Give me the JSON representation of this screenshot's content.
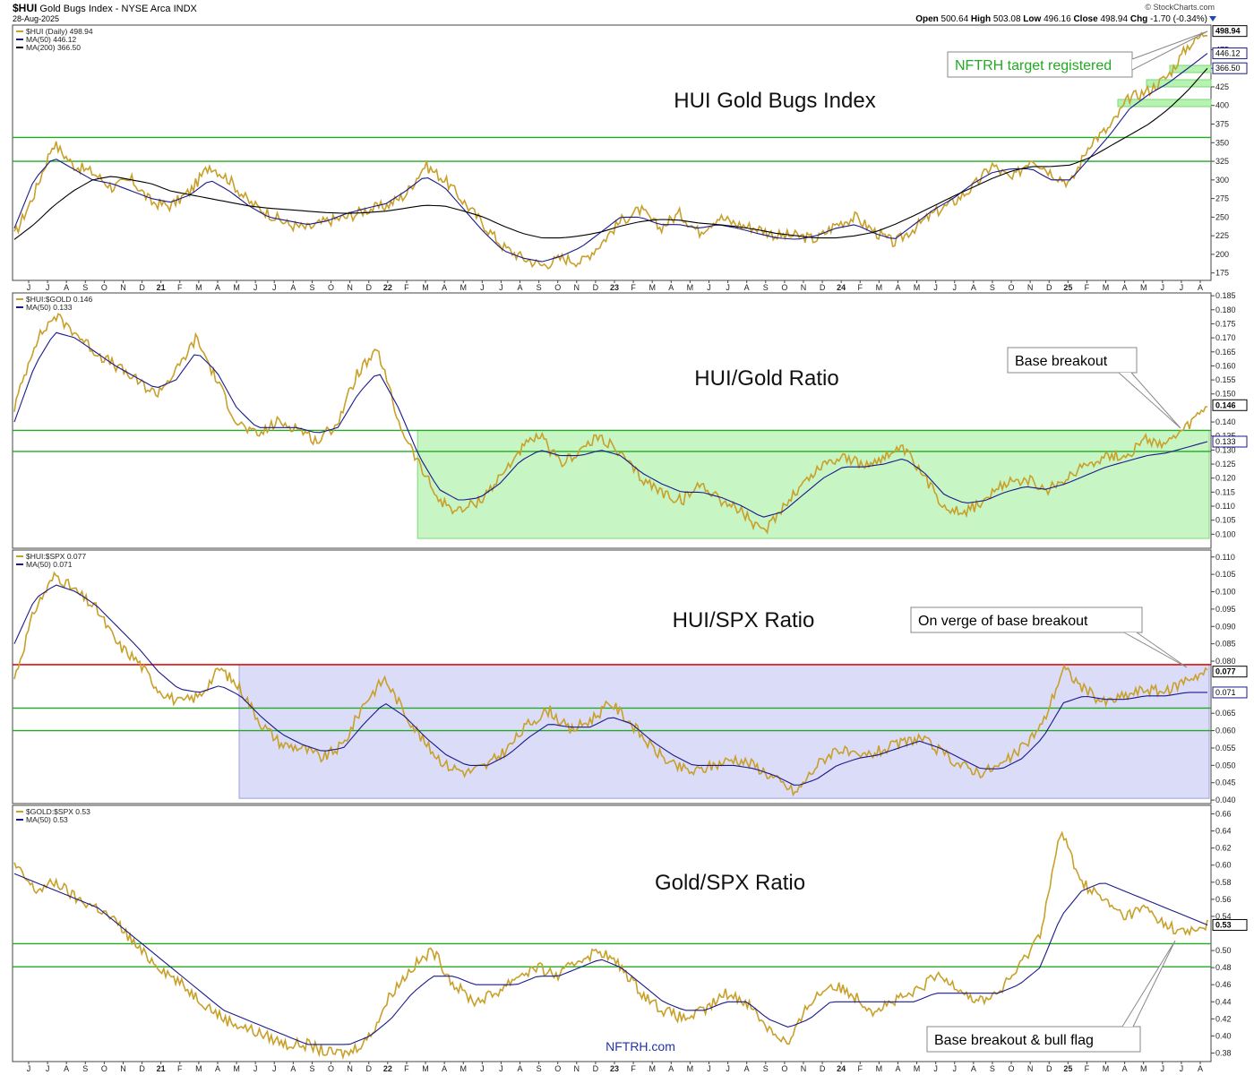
{
  "header": {
    "symbol": "$HUI",
    "name": "Gold Bugs Index - NYSE Arca INDX",
    "date": "28-Aug-2025",
    "credit": "© StockCharts.com",
    "open_label": "Open",
    "open": "500.64",
    "high_label": "High",
    "high": "503.08",
    "low_label": "Low",
    "low": "496.16",
    "close_label": "Close",
    "close": "498.94",
    "chg_label": "Chg",
    "chg": "-1.70 (-0.34%)"
  },
  "watermark": "NFTRH.com",
  "x_axis": {
    "months": [
      "J",
      "J",
      "A",
      "S",
      "O",
      "N",
      "D",
      "21",
      "F",
      "M",
      "A",
      "M",
      "J",
      "J",
      "A",
      "S",
      "O",
      "N",
      "D",
      "22",
      "F",
      "M",
      "A",
      "M",
      "J",
      "J",
      "A",
      "S",
      "O",
      "N",
      "D",
      "23",
      "F",
      "M",
      "A",
      "M",
      "J",
      "J",
      "A",
      "S",
      "O",
      "N",
      "D",
      "24",
      "F",
      "M",
      "A",
      "M",
      "J",
      "J",
      "A",
      "S",
      "O",
      "N",
      "D",
      "25",
      "F",
      "M",
      "A",
      "M",
      "J",
      "J",
      "A"
    ]
  },
  "colors": {
    "price": "#c8a02a",
    "ma50": "#1a1a8c",
    "ma200": "#000000",
    "support": "#22aa22",
    "resistance": "#dd1111",
    "green_zone": "#b6f2b0",
    "blue_zone": "#cfd0f5"
  },
  "chart_data": [
    {
      "type": "line",
      "title": "HUI Gold Bugs Index",
      "legend": [
        "$HUI (Daily) 498.94",
        "MA(50) 446.12",
        "MA(200) 366.50"
      ],
      "series": [
        {
          "name": "$HUI (Daily)",
          "values": [
            225,
            280,
            350,
            320,
            310,
            290,
            300,
            270,
            265,
            285,
            320,
            300,
            270,
            255,
            240,
            235,
            245,
            250,
            260,
            265,
            280,
            320,
            300,
            270,
            240,
            210,
            195,
            185,
            195,
            190,
            215,
            245,
            260,
            235,
            255,
            230,
            250,
            240,
            235,
            225,
            225,
            220,
            240,
            250,
            230,
            215,
            235,
            255,
            270,
            290,
            320,
            300,
            330,
            310,
            295,
            350,
            370,
            410,
            420,
            440,
            480,
            500
          ]
        },
        {
          "name": "MA(50)",
          "values": [
            235,
            300,
            330,
            315,
            300,
            295,
            285,
            275,
            270,
            280,
            300,
            285,
            265,
            250,
            245,
            240,
            245,
            255,
            262,
            268,
            285,
            305,
            290,
            260,
            230,
            205,
            195,
            190,
            198,
            210,
            230,
            250,
            250,
            240,
            240,
            235,
            240,
            235,
            228,
            222,
            220,
            225,
            235,
            240,
            228,
            220,
            240,
            260,
            275,
            295,
            310,
            315,
            315,
            300,
            300,
            330,
            360,
            395,
            415,
            430,
            450,
            470
          ]
        },
        {
          "name": "MA(200)",
          "values": [
            220,
            240,
            265,
            285,
            300,
            305,
            300,
            295,
            285,
            280,
            275,
            270,
            265,
            262,
            260,
            258,
            256,
            255,
            256,
            258,
            262,
            266,
            265,
            258,
            250,
            238,
            228,
            222,
            222,
            225,
            230,
            238,
            244,
            247,
            246,
            242,
            240,
            237,
            233,
            228,
            225,
            222,
            222,
            225,
            230,
            240,
            252,
            265,
            278,
            290,
            302,
            312,
            318,
            318,
            320,
            330,
            345,
            360,
            375,
            395,
            420,
            450
          ]
        }
      ],
      "levels": [
        357,
        325
      ],
      "ylim": [
        165,
        508
      ],
      "y_ticks": [
        "475",
        "450",
        "425",
        "400",
        "375",
        "350",
        "325",
        "300",
        "275",
        "250",
        "225",
        "200",
        "175"
      ],
      "last_labels": [
        "498.94",
        "446.12",
        "366.50"
      ],
      "annotation": "NFTRH target registered"
    },
    {
      "type": "line",
      "title": "HUI/Gold Ratio",
      "legend": [
        "$HUI:$GOLD 0.146",
        "MA(50) 0.133"
      ],
      "series": [
        {
          "name": "$HUI:$GOLD",
          "values": [
            0.145,
            0.168,
            0.178,
            0.172,
            0.165,
            0.16,
            0.155,
            0.15,
            0.158,
            0.17,
            0.155,
            0.14,
            0.135,
            0.14,
            0.138,
            0.133,
            0.14,
            0.158,
            0.165,
            0.14,
            0.125,
            0.112,
            0.108,
            0.112,
            0.12,
            0.13,
            0.135,
            0.125,
            0.13,
            0.135,
            0.128,
            0.12,
            0.115,
            0.112,
            0.118,
            0.112,
            0.108,
            0.1,
            0.11,
            0.118,
            0.125,
            0.128,
            0.124,
            0.128,
            0.13,
            0.12,
            0.11,
            0.108,
            0.112,
            0.118,
            0.12,
            0.115,
            0.12,
            0.125,
            0.128,
            0.128,
            0.134,
            0.132,
            0.138,
            0.146
          ]
        },
        {
          "name": "MA(50)",
          "values": [
            0.14,
            0.16,
            0.172,
            0.17,
            0.165,
            0.16,
            0.156,
            0.152,
            0.155,
            0.165,
            0.158,
            0.145,
            0.138,
            0.138,
            0.138,
            0.136,
            0.138,
            0.15,
            0.158,
            0.145,
            0.128,
            0.116,
            0.112,
            0.113,
            0.118,
            0.126,
            0.13,
            0.128,
            0.128,
            0.13,
            0.128,
            0.122,
            0.118,
            0.115,
            0.115,
            0.113,
            0.11,
            0.106,
            0.108,
            0.114,
            0.12,
            0.124,
            0.124,
            0.125,
            0.127,
            0.122,
            0.114,
            0.111,
            0.112,
            0.115,
            0.117,
            0.116,
            0.118,
            0.121,
            0.124,
            0.126,
            0.128,
            0.129,
            0.131,
            0.133
          ]
        }
      ],
      "levels": [
        0.137,
        0.1295
      ],
      "zone": {
        "from_index": 20,
        "y_range": [
          0.0985,
          0.137
        ]
      },
      "ylim": [
        0.095,
        0.186
      ],
      "y_ticks": [
        "0.185",
        "0.180",
        "0.175",
        "0.170",
        "0.165",
        "0.160",
        "0.155",
        "0.150",
        "0.140",
        "0.135",
        "0.130",
        "0.125",
        "0.120",
        "0.115",
        "0.110",
        "0.105",
        "0.100"
      ],
      "last_labels": [
        "0.146",
        "0.133"
      ],
      "annotation": "Base breakout"
    },
    {
      "type": "line",
      "title": "HUI/SPX Ratio",
      "legend": [
        "$HUI:$SPX 0.077",
        "MA(50) 0.071"
      ],
      "series": [
        {
          "name": "$HUI:$SPX",
          "values": [
            0.075,
            0.095,
            0.105,
            0.1,
            0.095,
            0.085,
            0.08,
            0.072,
            0.068,
            0.07,
            0.078,
            0.072,
            0.062,
            0.056,
            0.055,
            0.052,
            0.056,
            0.068,
            0.075,
            0.065,
            0.056,
            0.05,
            0.048,
            0.05,
            0.055,
            0.062,
            0.066,
            0.06,
            0.063,
            0.068,
            0.062,
            0.055,
            0.05,
            0.048,
            0.05,
            0.052,
            0.05,
            0.046,
            0.042,
            0.05,
            0.055,
            0.052,
            0.054,
            0.056,
            0.058,
            0.054,
            0.05,
            0.048,
            0.05,
            0.055,
            0.062,
            0.078,
            0.072,
            0.068,
            0.07,
            0.072,
            0.071,
            0.075,
            0.077
          ]
        },
        {
          "name": "MA(50)",
          "values": [
            0.085,
            0.098,
            0.102,
            0.1,
            0.096,
            0.09,
            0.084,
            0.077,
            0.072,
            0.071,
            0.073,
            0.07,
            0.064,
            0.059,
            0.056,
            0.054,
            0.055,
            0.062,
            0.068,
            0.064,
            0.058,
            0.053,
            0.05,
            0.05,
            0.053,
            0.058,
            0.062,
            0.061,
            0.061,
            0.064,
            0.062,
            0.057,
            0.053,
            0.05,
            0.05,
            0.05,
            0.049,
            0.047,
            0.044,
            0.046,
            0.05,
            0.052,
            0.053,
            0.055,
            0.057,
            0.055,
            0.052,
            0.049,
            0.049,
            0.052,
            0.058,
            0.068,
            0.07,
            0.069,
            0.069,
            0.07,
            0.07,
            0.071,
            0.071
          ]
        }
      ],
      "levels": [
        0.0665,
        0.06
      ],
      "resistance": 0.079,
      "zone": {
        "from_index": 11,
        "y_range": [
          0.0405,
          0.079
        ]
      },
      "ylim": [
        0.039,
        0.112
      ],
      "y_ticks": [
        "0.110",
        "0.105",
        "0.100",
        "0.095",
        "0.090",
        "0.085",
        "0.080",
        "0.065",
        "0.060",
        "0.055",
        "0.050",
        "0.045",
        "0.040"
      ],
      "last_labels": [
        "0.077",
        "0.071"
      ],
      "annotation": "On verge of base breakout"
    },
    {
      "type": "line",
      "title": "Gold/SPX Ratio",
      "legend": [
        "$GOLD:$SPX 0.53",
        "MA(50) 0.53"
      ],
      "series": [
        {
          "name": "$GOLD:$SPX",
          "values": [
            0.6,
            0.57,
            0.58,
            0.56,
            0.55,
            0.53,
            0.5,
            0.48,
            0.46,
            0.44,
            0.42,
            0.41,
            0.4,
            0.39,
            0.39,
            0.38,
            0.38,
            0.4,
            0.45,
            0.48,
            0.5,
            0.46,
            0.44,
            0.45,
            0.47,
            0.48,
            0.47,
            0.49,
            0.5,
            0.48,
            0.45,
            0.43,
            0.42,
            0.43,
            0.45,
            0.44,
            0.41,
            0.39,
            0.44,
            0.46,
            0.45,
            0.43,
            0.44,
            0.45,
            0.47,
            0.46,
            0.44,
            0.45,
            0.48,
            0.52,
            0.64,
            0.58,
            0.56,
            0.54,
            0.55,
            0.53,
            0.52,
            0.53
          ]
        },
        {
          "name": "MA(50)",
          "values": [
            0.59,
            0.58,
            0.57,
            0.56,
            0.55,
            0.53,
            0.51,
            0.49,
            0.47,
            0.45,
            0.43,
            0.42,
            0.41,
            0.4,
            0.39,
            0.39,
            0.39,
            0.4,
            0.42,
            0.45,
            0.47,
            0.47,
            0.46,
            0.46,
            0.46,
            0.47,
            0.47,
            0.48,
            0.49,
            0.48,
            0.46,
            0.44,
            0.43,
            0.43,
            0.44,
            0.44,
            0.42,
            0.41,
            0.42,
            0.44,
            0.44,
            0.44,
            0.44,
            0.44,
            0.45,
            0.45,
            0.45,
            0.45,
            0.46,
            0.48,
            0.54,
            0.57,
            0.58,
            0.57,
            0.56,
            0.55,
            0.54,
            0.53
          ]
        }
      ],
      "levels": [
        0.508,
        0.481
      ],
      "ylim": [
        0.37,
        0.67
      ],
      "y_ticks": [
        "0.66",
        "0.64",
        "0.62",
        "0.60",
        "0.58",
        "0.56",
        "0.54",
        "0.50",
        "0.48",
        "0.46",
        "0.44",
        "0.42",
        "0.40",
        "0.38"
      ],
      "last_labels": [
        "0.53"
      ],
      "annotation": "Base breakout & bull flag"
    }
  ]
}
